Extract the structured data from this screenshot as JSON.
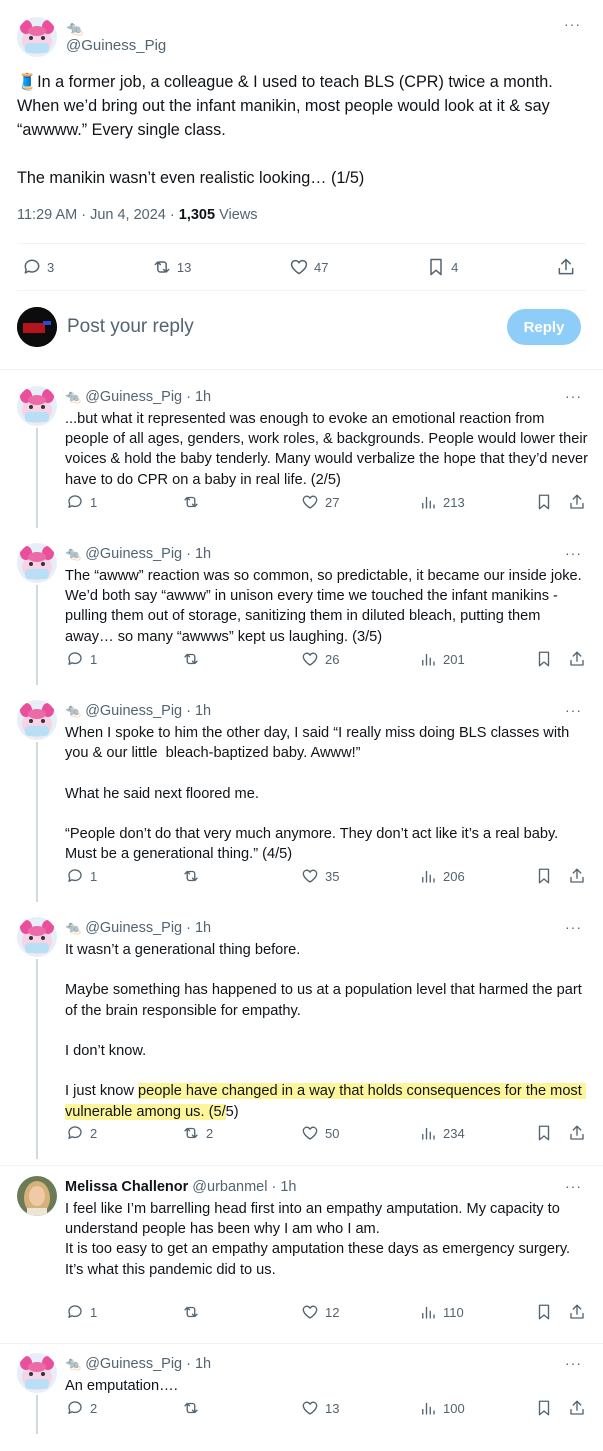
{
  "main_tweet": {
    "author_emoji": "🐀",
    "handle": "@Guiness_Pig",
    "text": "🧵In a former job, a colleague & I used to teach BLS (CPR) twice a month. When we’d bring out the infant manikin, most people would look at it & say “awwww.” Every single class.\n\nThe manikin wasn’t even realistic looking… (1/5)",
    "time": "11:29 AM · Jun 4, 2024 · ",
    "views_count": "1,305",
    "views_label": " Views",
    "more": "···",
    "replies": "3",
    "reposts": "13",
    "likes": "47",
    "bookmarks": "4"
  },
  "composer": {
    "placeholder": "Post your reply",
    "button": "Reply"
  },
  "replies": [
    {
      "name": "",
      "emoji": "🐀",
      "handle": "@Guiness_Pig",
      "time": "· 1h",
      "text": "...but what it represented was enough to evoke an emotional reaction from people of all ages, genders, work roles, & backgrounds. People would lower their voices & hold the baby tenderly. Many would verbalize the hope that they’d never have to do CPR on a baby in real life. (2/5)",
      "replies": "1",
      "reposts": "",
      "likes": "27",
      "views": "213"
    },
    {
      "name": "",
      "emoji": "🐀",
      "handle": "@Guiness_Pig",
      "time": "· 1h",
      "text": "The “awww” reaction was so common, so predictable, it became our inside joke. We’d both say “awww” in unison every time we touched the infant manikins - pulling them out of storage, sanitizing them in diluted bleach, putting them away… so many “awwws” kept us laughing. (3/5)",
      "replies": "1",
      "reposts": "",
      "likes": "26",
      "views": "201"
    },
    {
      "name": "",
      "emoji": "🐀",
      "handle": "@Guiness_Pig",
      "time": "· 1h",
      "text": "When I spoke to him the other day, I said “I really miss doing BLS classes with you & our little  bleach-baptized baby. Awww!”\n\nWhat he said next floored me.\n\n“People don’t do that very much anymore. They don’t act like it’s a real baby. Must be a generational thing.” (4/5)",
      "replies": "1",
      "reposts": "",
      "likes": "35",
      "views": "206"
    },
    {
      "name": "",
      "emoji": "🐀",
      "handle": "@Guiness_Pig",
      "time": "· 1h",
      "text_before": "It wasn’t a generational thing before.\n\nMaybe something has happened to us at a population level that harmed the part of the brain responsible for empathy.\n\nI don’t know.\n\nI just know ",
      "text_highlight": "people have changed in a way that holds consequences for the most vulnerable among us. (5/",
      "text_after": "5)",
      "replies": "2",
      "reposts": "2",
      "likes": "50",
      "views": "234"
    },
    {
      "name": "Melissa Challenor",
      "emoji": "",
      "handle": "@urbanmel",
      "time": "· 1h",
      "text": "I feel like I’m barrelling head first into an empathy amputation. My capacity to understand people has been why I am who I am.\nIt is too easy to get an empathy amputation these days as emergency surgery.\nIt’s what this pandemic did to us.",
      "replies": "1",
      "reposts": "",
      "likes": "12",
      "views": "110"
    },
    {
      "name": "",
      "emoji": "🐀",
      "handle": "@Guiness_Pig",
      "time": "· 1h",
      "text": "An emputation….",
      "replies": "2",
      "reposts": "",
      "likes": "13",
      "views": "100"
    }
  ],
  "more_label": "···",
  "colors": {
    "accent": "#1d9bf0",
    "reply_button": "#8ecdf7",
    "highlight": "#fdf59a",
    "muted": "#536471"
  }
}
